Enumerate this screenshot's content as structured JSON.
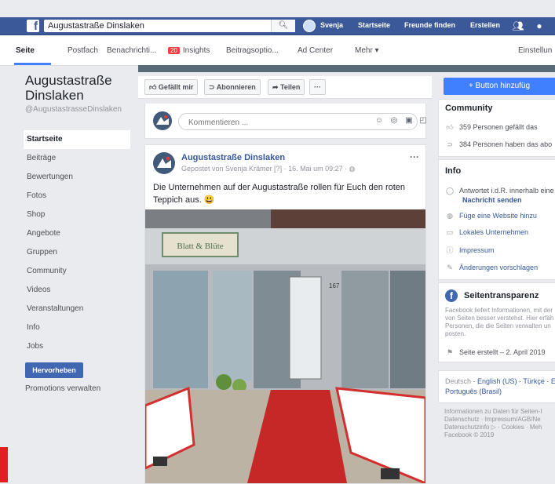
{
  "topbar": {
    "search_value": "Augustastraße Dinslaken",
    "user_name": "Svenja",
    "links": [
      "Startseite",
      "Freunde finden",
      "Erstellen"
    ]
  },
  "page_tabs": {
    "seite": "Seite",
    "postfach": "Postfach",
    "benachrichtigungen": "Benachrichti...",
    "notif_count": "20",
    "insights": "Insights",
    "beitragsoptionen": "Beitragsoptio...",
    "ad_center": "Ad Center",
    "mehr": "Mehr ▾",
    "einstellungen": "Einstellun"
  },
  "page": {
    "name": "Augustastraße Dinslaken",
    "handle": "@AugustastrasseDinslaken"
  },
  "sidebar": {
    "items": [
      "Startseite",
      "Beiträge",
      "Bewertungen",
      "Fotos",
      "Shop",
      "Angebote",
      "Gruppen",
      "Community",
      "Videos",
      "Veranstaltungen",
      "Info",
      "Jobs"
    ],
    "promote_label": "Hervorheben",
    "promotions_label": "Promotions verwalten"
  },
  "actions": {
    "like": "Gefällt mir",
    "follow": "Abonnieren",
    "share": "Teilen",
    "more": "···",
    "cta": "+ Button hinzufüg"
  },
  "comment": {
    "placeholder": "Kommentieren ..."
  },
  "post": {
    "author": "Augustastraße Dinslaken",
    "meta": "Gepostet von Svenja Krämer [?] · 16. Mai um 09:27 ·",
    "more": "···",
    "text": "Die Unternehmen auf der Augustastraße rollen für Euch den roten Teppich aus. 😃",
    "shop_sign": "Blatt & Blüte",
    "house_number": "167"
  },
  "community": {
    "title": "Community",
    "likes": "359 Personen gefällt das",
    "follows": "384 Personen haben das abo"
  },
  "info": {
    "title": "Info",
    "response": "Antwortet i.d.R. innerhalb eine",
    "send_message": "Nachricht senden",
    "add_website": "Füge eine Website hinzu",
    "category": "Lokales Unternehmen",
    "impressum": "Impressum",
    "suggest": "Änderungen vorschlagen"
  },
  "transparency": {
    "title": "Seitentransparenz",
    "body": "Facebook liefert Informationen, mit der von Seiten besser verstehst. Hier erfäh Personen, die die Seiten verwalten un posten.",
    "created": "Seite erstellt – 2. April 2019"
  },
  "languages": {
    "line1": [
      "Deutsch",
      "English (US)",
      "Türkçe",
      "E"
    ],
    "line2": "Português (Brasil)"
  },
  "footer": {
    "line1": "Informationen zu Daten für Seiten-I",
    "line2": "Datenschutz · Impressum/AGB/Ne",
    "line3": "Datenschutzinfo ▷ · Cookies · Meh",
    "line4": "Facebook © 2019"
  },
  "colors": {
    "brand": "#3b5998",
    "accent": "#4080ff",
    "carpet": "#c62828"
  }
}
